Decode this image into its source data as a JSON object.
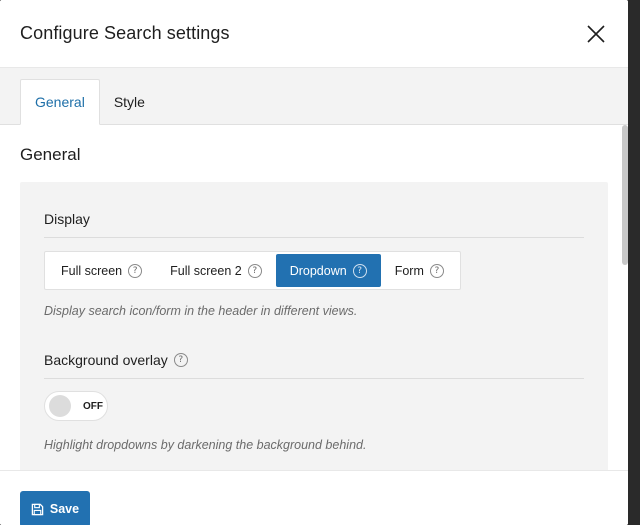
{
  "modal": {
    "title": "Configure Search settings"
  },
  "tabs": [
    {
      "label": "General",
      "active": true
    },
    {
      "label": "Style",
      "active": false
    }
  ],
  "section": {
    "title": "General"
  },
  "display": {
    "label": "Display",
    "options": [
      {
        "label": "Full screen",
        "active": false
      },
      {
        "label": "Full screen 2",
        "active": false
      },
      {
        "label": "Dropdown",
        "active": true
      },
      {
        "label": "Form",
        "active": false
      }
    ],
    "hint": "Display search icon/form in the header in different views."
  },
  "background_overlay": {
    "label": "Background overlay",
    "toggle_text": "OFF",
    "enabled": false,
    "hint": "Highlight dropdowns by darkening the background behind."
  },
  "footer": {
    "save_label": "Save"
  },
  "help_glyph": "?",
  "colors": {
    "accent": "#2271b1",
    "active_tab_text": "#1e6fa8",
    "panel_bg": "#f3f3f3"
  }
}
